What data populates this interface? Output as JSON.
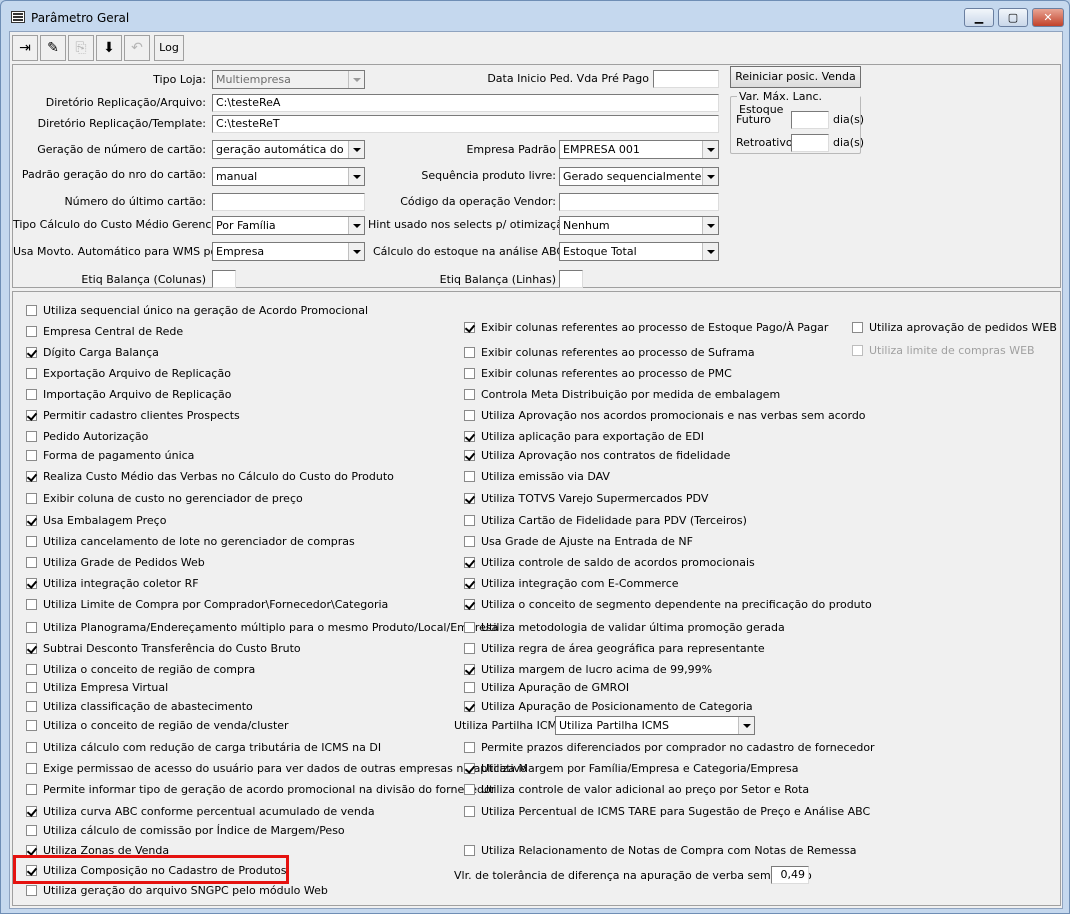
{
  "window": {
    "title": "Parâmetro Geral",
    "min": "▁",
    "max": "▢",
    "close": "✕"
  },
  "toolbar": {
    "log_label": "Log"
  },
  "fields": {
    "tipo_loja": {
      "label": "Tipo Loja:",
      "value": "Multiempresa"
    },
    "dir_repl_arquivo": {
      "label": "Diretório Replicação/Arquivo:",
      "value": "C:\\testeReA"
    },
    "dir_repl_template": {
      "label": "Diretório Replicação/Template:",
      "value": "C:\\testeReT"
    },
    "geracao_cartao": {
      "label": "Geração de número de cartão:",
      "value": "geração automática do núm"
    },
    "padrao_geracao": {
      "label": "Padrão geração do nro do cartão:",
      "value": "manual"
    },
    "numero_ultimo_cartao": {
      "label": "Número do último cartão:",
      "value": ""
    },
    "tipo_calculo": {
      "label": "Tipo Cálculo do Custo Médio Gerencial:",
      "value": "Por Família"
    },
    "usa_movto_wms": {
      "label": "Usa Movto. Automático para WMS por",
      "value": "Empresa"
    },
    "etiq_colunas": {
      "label": "Etiq Balança (Colunas)",
      "value": ""
    },
    "data_inicio": {
      "label": "Data Inicio Ped. Vda Pré Pago",
      "value": ""
    },
    "empresa_padrao": {
      "label": "Empresa Padrão",
      "value": "EMPRESA 001"
    },
    "sequencia_produto": {
      "label": "Sequência produto livre:",
      "value": "Gerado sequencialmente"
    },
    "codigo_operacao": {
      "label": "Código da operação Vendor:",
      "value": ""
    },
    "hint_selects": {
      "label": "Hint usado nos selects p/ otimização:",
      "value": "Nenhum"
    },
    "calculo_estoque": {
      "label": "Cálculo do estoque na análise ABC:",
      "value": "Estoque Total"
    },
    "etiq_linhas": {
      "label": "Etiq Balança (Linhas)",
      "value": ""
    },
    "reiniciar_btn": "Reiniciar posic. Venda",
    "var_group": "Var. Máx. Lanc. Estoque",
    "futuro": {
      "label": "Futuro",
      "value": "",
      "unit": "dia(s)"
    },
    "retroativo": {
      "label": "Retroativo",
      "value": "",
      "unit": "dia(s)"
    },
    "partilha": {
      "label": "Utiliza Partilha ICMS",
      "value": "Utiliza Partilha ICMS"
    },
    "tolerancia": {
      "label": "Vlr. de tolerância de diferença na apuração de verba sem acordo",
      "value": "0,49"
    }
  },
  "col1": [
    {
      "label": "Utiliza sequencial único na geração de Acordo Promocional",
      "checked": false
    },
    {
      "label": "Empresa Central de Rede",
      "checked": false
    },
    {
      "label": "Dígito Carga Balança",
      "checked": true
    },
    {
      "label": "Exportação Arquivo de Replicação",
      "checked": false
    },
    {
      "label": "Importação Arquivo de Replicação",
      "checked": false
    },
    {
      "label": "Permitir cadastro clientes Prospects",
      "checked": true
    },
    {
      "label": "Pedido Autorização",
      "checked": false
    },
    {
      "label": "Forma de pagamento única",
      "checked": false
    },
    {
      "label": "Realiza Custo Médio das Verbas no Cálculo do Custo do Produto",
      "checked": true
    },
    {
      "label": "Exibir coluna de custo no gerenciador de preço",
      "checked": false
    },
    {
      "label": "Usa Embalagem Preço",
      "checked": true
    },
    {
      "label": "Utiliza cancelamento de lote no gerenciador de compras",
      "checked": false
    },
    {
      "label": "Utiliza Grade de Pedidos Web",
      "checked": false
    },
    {
      "label": "Utiliza integração coletor RF",
      "checked": true
    },
    {
      "label": "Utiliza Limite de Compra por Comprador\\Fornecedor\\Categoria",
      "checked": false
    },
    {
      "label": "Utiliza Planograma/Endereçamento múltiplo para o mesmo Produto/Local/Empresa",
      "checked": false
    },
    {
      "label": "Subtrai Desconto Transferência do Custo Bruto",
      "checked": true
    },
    {
      "label": "Utiliza o conceito de região de compra",
      "checked": false
    },
    {
      "label": "Utiliza Empresa Virtual",
      "checked": false
    },
    {
      "label": "Utiliza classificação de abastecimento",
      "checked": false
    },
    {
      "label": "Utiliza o conceito de região de venda/cluster",
      "checked": false
    },
    {
      "label": "Utiliza cálculo com redução de carga tributária de ICMS na DI",
      "checked": false
    },
    {
      "label": "Exige permissao de acesso do usuário para ver dados de outras empresas no aplicativo",
      "checked": false
    },
    {
      "label": "Permite informar tipo de geração de acordo promocional na divisão do fornecedor",
      "checked": false
    },
    {
      "label": "Utiliza curva ABC conforme percentual acumulado de venda",
      "checked": true
    },
    {
      "label": "Utiliza cálculo de comissão por Índice de Margem/Peso",
      "checked": false
    },
    {
      "label": "Utiliza Zonas de Venda",
      "checked": true
    },
    {
      "label": "Utiliza Composição no Cadastro de Produtos",
      "checked": true
    },
    {
      "label": "Utiliza geração do arquivo SNGPC pelo módulo Web",
      "checked": false
    }
  ],
  "col2": [
    {
      "label": "Exibir colunas referentes ao processo de Estoque Pago/À Pagar",
      "checked": true
    },
    {
      "label": "Exibir colunas referentes ao processo de Suframa",
      "checked": false
    },
    {
      "label": "Exibir colunas referentes ao processo de PMC",
      "checked": false
    },
    {
      "label": "Controla Meta Distribuição por medida de embalagem",
      "checked": false
    },
    {
      "label": "Utiliza Aprovação nos acordos promocionais e nas verbas sem acordo",
      "checked": false
    },
    {
      "label": "Utiliza aplicação para exportação de EDI",
      "checked": true
    },
    {
      "label": "Utiliza Aprovação nos contratos de fidelidade",
      "checked": true
    },
    {
      "label": "Utiliza emissão via DAV",
      "checked": false
    },
    {
      "label": "Utiliza TOTVS Varejo Supermercados PDV",
      "checked": true
    },
    {
      "label": "Utiliza Cartão de Fidelidade para PDV (Terceiros)",
      "checked": false
    },
    {
      "label": "Usa Grade de Ajuste na Entrada de NF",
      "checked": false
    },
    {
      "label": "Utiliza controle de saldo de acordos promocionais",
      "checked": true
    },
    {
      "label": "Utiliza integração com E-Commerce",
      "checked": true
    },
    {
      "label": "Utiliza o conceito de segmento dependente na precificação do produto",
      "checked": true
    },
    {
      "label": "Utiliza metodologia de validar última promoção gerada",
      "checked": false
    },
    {
      "label": "Utiliza regra de área geográfica para representante",
      "checked": false
    },
    {
      "label": "Utiliza margem de lucro acima de 99,99%",
      "checked": true
    },
    {
      "label": "Utiliza Apuração de GMROI",
      "checked": false
    },
    {
      "label": "Utiliza Apuração de Posicionamento de Categoria",
      "checked": true
    },
    {
      "label": "Permite prazos diferenciados por comprador no cadastro de fornecedor",
      "checked": false
    },
    {
      "label": "Utiliza Margem por Família/Empresa e Categoria/Empresa",
      "checked": true
    },
    {
      "label": "Utiliza controle de valor adicional ao preço por Setor e Rota",
      "checked": false
    },
    {
      "label": "Utiliza Percentual de ICMS TARE para Sugestão de Preço e Análise ABC",
      "checked": false
    },
    {
      "label": "Utiliza Relacionamento de Notas de Compra com Notas de Remessa",
      "checked": false
    }
  ],
  "col3": [
    {
      "label": "Utiliza aprovação de pedidos WEB",
      "checked": false,
      "disabled": false
    },
    {
      "label": "Utiliza limite de compras WEB",
      "checked": false,
      "disabled": true
    }
  ]
}
